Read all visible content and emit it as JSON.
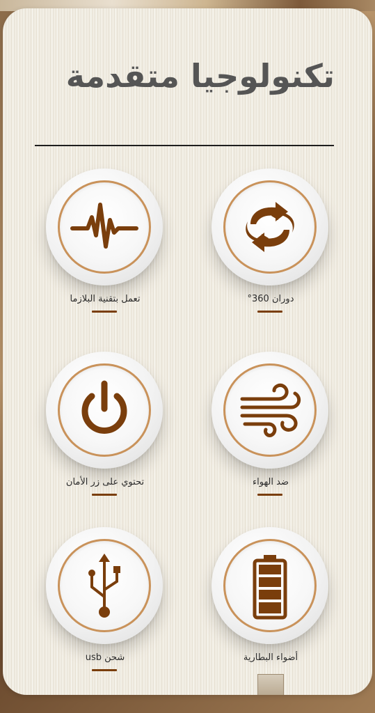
{
  "title": "تكنولوجيا متقدمة",
  "features": [
    {
      "label": "دوران 360°",
      "icon": "rotate-360-icon"
    },
    {
      "label": "تعمل بتقنية البلازما",
      "icon": "pulse-wave-icon"
    },
    {
      "label": "ضد الهواء",
      "icon": "wind-icon"
    },
    {
      "label": "تحتوي على زر الأمان",
      "icon": "power-icon"
    },
    {
      "label": "أضواء البطارية",
      "icon": "battery-icon"
    },
    {
      "label": "شحن usb",
      "icon": "usb-icon"
    }
  ],
  "colors": {
    "accent": "#7a3e0c",
    "ring": "#c9925a",
    "title": "#555555"
  }
}
